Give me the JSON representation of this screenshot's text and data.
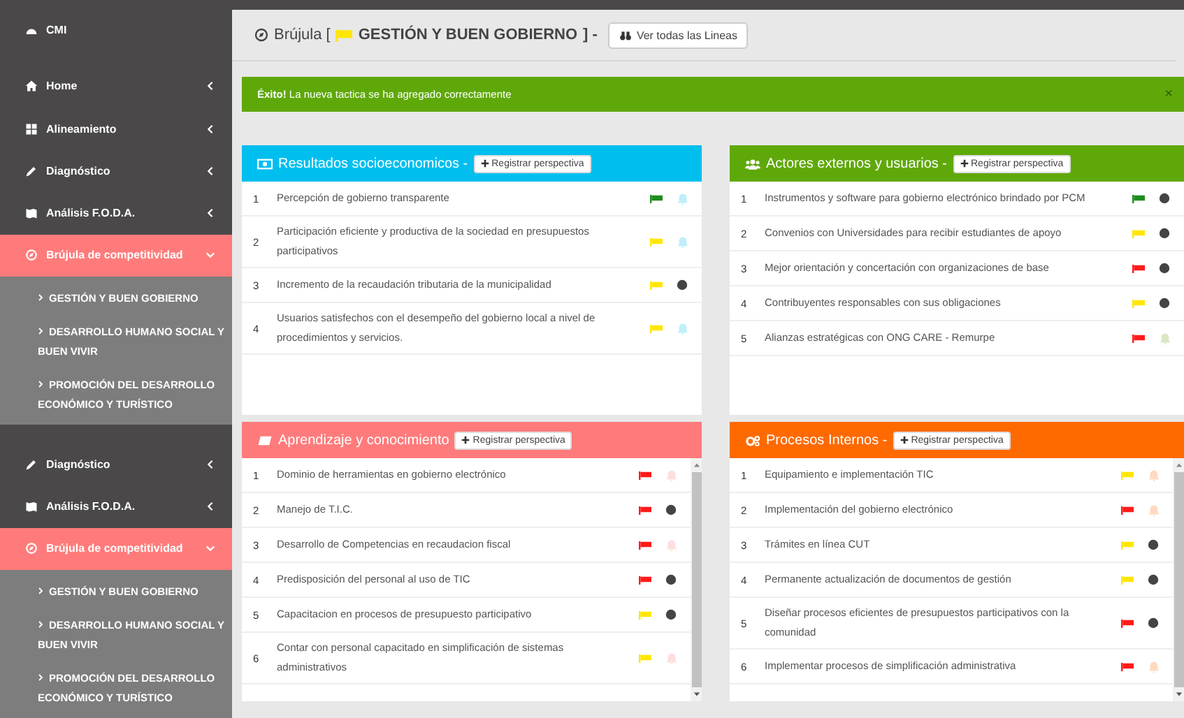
{
  "sidebar": {
    "brand": "CMI",
    "groups": [
      {
        "items": [
          {
            "label": "Home",
            "kind": "home",
            "selected": false,
            "expanded": false
          },
          {
            "label": "Alineamiento",
            "kind": "grid",
            "selected": false,
            "expanded": false
          },
          {
            "label": "Diagnóstico",
            "kind": "pencil",
            "selected": false,
            "expanded": false
          },
          {
            "label": "Análisis F.O.D.A.",
            "kind": "map",
            "selected": false,
            "expanded": false
          },
          {
            "label": "Brújula de competitividad",
            "kind": "compass",
            "selected": true,
            "expanded": true,
            "children": [
              "GESTIÓN Y BUEN GOBIERNO",
              "DESARROLLO HUMANO SOCIAL Y BUEN VIVIR",
              "PROMOCIÓN DEL DESARROLLO ECONÓMICO Y TURÍSTICO"
            ]
          }
        ]
      },
      {
        "items": [
          {
            "label": "Diagnóstico",
            "kind": "pencil",
            "selected": false,
            "expanded": false
          },
          {
            "label": "Análisis F.O.D.A.",
            "kind": "map",
            "selected": false,
            "expanded": false
          },
          {
            "label": "Brújula de competitividad",
            "kind": "compass",
            "selected": true,
            "expanded": true,
            "children": [
              "GESTIÓN Y BUEN GOBIERNO",
              "DESARROLLO HUMANO SOCIAL Y BUEN VIVIR",
              "PROMOCIÓN DEL DESARROLLO ECONÓMICO Y TURÍSTICO"
            ]
          }
        ]
      }
    ]
  },
  "header": {
    "title_prefix": "Brújula [",
    "title_name": "GESTIÓN Y BUEN GOBIERNO",
    "title_suffix": "] -",
    "button": "Ver todas las Lineas"
  },
  "alert": {
    "strong": "Éxito!",
    "message": "La nueva tactica se ha agregado correctamente",
    "close": "×"
  },
  "panels": [
    {
      "title": "Resultados socioeconomicos -",
      "kind": "money",
      "color": "#00bfef",
      "button": "Registrar perspectiva",
      "scroll": false,
      "rows": [
        {
          "n": "1",
          "text": "Percepción de gobierno transparente",
          "color": "#1e8c1e",
          "kind": "bell"
        },
        {
          "n": "2",
          "text": "Participación eficiente y productiva de la sociedad en presupuestos participativos",
          "color": "#ffe600",
          "kind": "bell"
        },
        {
          "n": "3",
          "text": "Incremento de la recaudación tributaria de la municipalidad",
          "color": "#ffe600",
          "kind": "dot"
        },
        {
          "n": "4",
          "text": "Usuarios satisfechos con el desempeño del gobierno local a nivel de procedimientos y servicios.",
          "color": "#ffe600",
          "kind": "bell"
        }
      ]
    },
    {
      "title": "Actores externos y usuarios -",
      "kind": "users",
      "color": "#5fa80a",
      "button": "Registrar perspectiva",
      "scroll": false,
      "rows": [
        {
          "n": "1",
          "text": "Instrumentos y software para gobierno electrónico brindado por PCM",
          "color": "#1e8c1e",
          "kind": "dot"
        },
        {
          "n": "2",
          "text": "Convenios con Universidades para recibir estudiantes de apoyo",
          "color": "#ffe600",
          "kind": "dot"
        },
        {
          "n": "3",
          "text": "Mejor orientación y concertación con organizaciones de base",
          "color": "#ff1a1a",
          "kind": "dot"
        },
        {
          "n": "4",
          "text": "Contribuyentes responsables con sus obligaciones",
          "color": "#ffe600",
          "kind": "dot"
        },
        {
          "n": "5",
          "text": "Alianzas estratégicas con ONG CARE - Remurpe",
          "color": "#ff1a1a",
          "kind": "bell"
        }
      ]
    },
    {
      "title": "Aprendizaje y conocimiento",
      "kind": "book",
      "color": "#ff7b7b",
      "button": "Registrar perspectiva",
      "scroll": true,
      "rows": [
        {
          "n": "1",
          "text": "Dominio de herramientas en gobierno electrónico",
          "color": "#ff1a1a",
          "kind": "bell"
        },
        {
          "n": "2",
          "text": "Manejo de T.I.C.",
          "color": "#ff1a1a",
          "kind": "dot"
        },
        {
          "n": "3",
          "text": "Desarrollo de Competencias en recaudacion fiscal",
          "color": "#ff1a1a",
          "kind": "bell"
        },
        {
          "n": "4",
          "text": "Predisposición del personal al uso de TIC",
          "color": "#ff1a1a",
          "kind": "dot"
        },
        {
          "n": "5",
          "text": "Capacitacion en procesos de presupuesto participativo",
          "color": "#ffe600",
          "kind": "dot"
        },
        {
          "n": "6",
          "text": "Contar con personal capacitado en simplificación de sistemas administrativos",
          "color": "#ffe600",
          "kind": "bell"
        }
      ]
    },
    {
      "title": "Procesos Internos -",
      "kind": "cogs",
      "color": "#ff6a00",
      "button": "Registrar perspectiva",
      "scroll": true,
      "rows": [
        {
          "n": "1",
          "text": "Equipamiento e implementación TIC",
          "color": "#ffe600",
          "kind": "bell"
        },
        {
          "n": "2",
          "text": "Implementación del gobierno electrónico",
          "color": "#ff1a1a",
          "kind": "bell"
        },
        {
          "n": "3",
          "text": "Trámites en línea CUT",
          "color": "#ffe600",
          "kind": "dot"
        },
        {
          "n": "4",
          "text": "Permanente actualización de documentos de gestión",
          "color": "#ffe600",
          "kind": "dot"
        },
        {
          "n": "5",
          "text": "Diseñar procesos eficientes de presupuestos participativos con la comunidad",
          "color": "#ff1a1a",
          "kind": "dot"
        },
        {
          "n": "6",
          "text": "Implementar procesos de simplificación administrativa",
          "color": "#ff1a1a",
          "kind": "bell"
        }
      ]
    }
  ]
}
